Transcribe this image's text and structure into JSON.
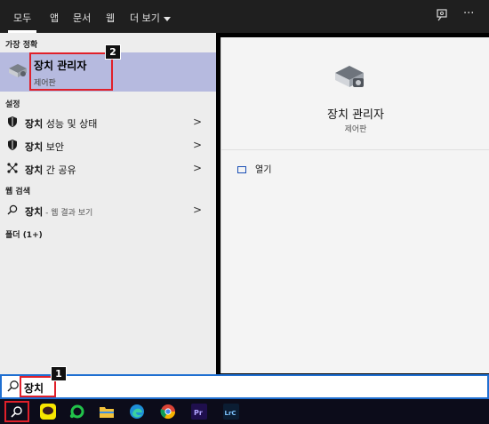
{
  "nav": {
    "tabs": [
      "모두",
      "앱",
      "문서",
      "웹",
      "더 보기"
    ],
    "active": "모두"
  },
  "left": {
    "best_match_header": "가장 정확",
    "best_match": {
      "title": "장치 관리자",
      "subtitle": "제어판"
    },
    "settings_header": "설정",
    "settings": [
      {
        "bold": "장치",
        "rest": " 성능 및 상태",
        "icon": "shield-icon"
      },
      {
        "bold": "장치",
        "rest": " 보안",
        "icon": "shield-icon"
      },
      {
        "bold": "장치",
        "rest": " 간 공유",
        "icon": "share-icon"
      }
    ],
    "web_header": "웹 검색",
    "web_item": {
      "bold": "장치",
      "rest": " - 웹 결과 보기"
    },
    "folders_header": "폴더 (1+)"
  },
  "right": {
    "title": "장치 관리자",
    "subtitle": "제어판",
    "open_label": "열기"
  },
  "search": {
    "value": "장치"
  },
  "callouts": {
    "one": "1",
    "two": "2"
  },
  "colors": {
    "accent": "#1f6fd1",
    "highlight": "#b6badf",
    "callout": "#e0202a"
  }
}
